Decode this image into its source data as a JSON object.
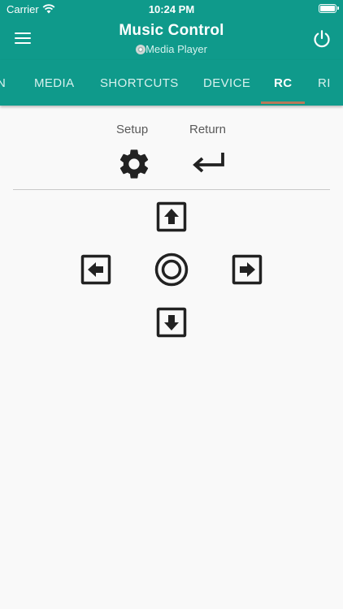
{
  "status": {
    "carrier": "Carrier",
    "time": "10:24 PM"
  },
  "header": {
    "title": "Music Control",
    "subtitle": "Media Player"
  },
  "tabs": [
    {
      "label": "N"
    },
    {
      "label": "MEDIA"
    },
    {
      "label": "SHORTCUTS"
    },
    {
      "label": "DEVICE"
    },
    {
      "label": "RC"
    },
    {
      "label": "RI"
    }
  ],
  "active_tab": "RC",
  "controls": {
    "setup_label": "Setup",
    "return_label": "Return"
  },
  "colors": {
    "accent": "#0f9a8b",
    "indicator": "#b9795a",
    "background": "#f9f9f9"
  },
  "icons": [
    "menu-icon",
    "power-icon",
    "gear-icon",
    "return-arrow-icon",
    "arrow-up-icon",
    "arrow-left-icon",
    "ok-circle-icon",
    "arrow-right-icon",
    "arrow-down-icon"
  ]
}
